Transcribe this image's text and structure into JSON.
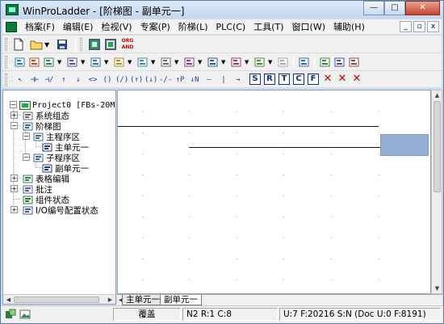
{
  "window": {
    "title": "WinProLadder - [阶梯图 - 副单元一]",
    "controls": {
      "minimize": "—",
      "maximize": "□",
      "close": "✕"
    }
  },
  "menubar": {
    "items": [
      {
        "label": "档案(F)"
      },
      {
        "label": "编辑(E)"
      },
      {
        "label": "检视(V)"
      },
      {
        "label": "专案(P)"
      },
      {
        "label": "阶梯(L)"
      },
      {
        "label": "PLC(C)"
      },
      {
        "label": "工具(T)"
      },
      {
        "label": "窗口(W)"
      },
      {
        "label": "辅助(H)"
      }
    ],
    "mdi_controls": {
      "minimize": "_",
      "restore": "▫",
      "close": "x"
    }
  },
  "toolbar_row1": {
    "icons": [
      "new-file-icon",
      "open-folder-icon",
      "save-icon",
      "run-mode-icon",
      "stop-mode-icon"
    ],
    "org_and": {
      "line1": "ORG",
      "line2": "AND"
    }
  },
  "toolbar_row2": {
    "icons": [
      "compile-icon",
      "ladder-edit-icon",
      "book-icon",
      "device-monitor-icon",
      "register-icon",
      "contact-status-icon",
      "output-coil-icon",
      "gear-run-icon",
      "timer-icon",
      "bit-set-icon",
      "branch-insert-icon",
      "counter-icon",
      "page-icon",
      "zoom-icon",
      "list-icon",
      "matrix-icon",
      "contact-search-icon"
    ]
  },
  "toolbar_row3": {
    "symbols": [
      "↖",
      "⊣⊢",
      "⊣/⊢",
      "↑",
      "↓",
      "<>",
      "()",
      "(/)",
      "(↑)",
      "(↓)",
      "-/-",
      "↑P",
      "↓N",
      "—",
      "|",
      "→"
    ],
    "boxes": [
      "S",
      "R",
      "T",
      "C",
      "F",
      "✕",
      "✕",
      "✕"
    ]
  },
  "project_tree": {
    "root": "Project0 [FBs-20M",
    "nodes": [
      {
        "label": "系统组态",
        "icon": "system-config-icon",
        "toggle": "+"
      },
      {
        "label": "阶梯图",
        "icon": "ladder-diagram-icon",
        "toggle": "−"
      },
      {
        "label": "主程序区",
        "icon": "main-program-icon",
        "toggle": "−"
      },
      {
        "label": "主单元一",
        "icon": "program-unit-icon",
        "toggle": ""
      },
      {
        "label": "子程序区",
        "icon": "subprogram-icon",
        "toggle": "−"
      },
      {
        "label": "副单元一",
        "icon": "program-unit-icon",
        "toggle": ""
      },
      {
        "label": "表格编辑",
        "icon": "table-edit-icon",
        "toggle": "+"
      },
      {
        "label": "批注",
        "icon": "comment-icon",
        "toggle": "+"
      },
      {
        "label": "组件状态",
        "icon": "device-status-icon",
        "toggle": ""
      },
      {
        "label": "I/O编号配置状态",
        "icon": "io-config-icon",
        "toggle": "+"
      }
    ]
  },
  "sheet_tabs": [
    {
      "label": "主单元一"
    },
    {
      "label": "副单元一"
    }
  ],
  "statusbar": {
    "mode": "覆盖",
    "position": "N2 R:1 C:8",
    "memory": "U:7 F:20216 S:N (Doc U:0 F:8191)"
  },
  "colors": {
    "cursor_cell": "#94aed4",
    "rung_line": "#111111",
    "close_button": "#c74631"
  }
}
